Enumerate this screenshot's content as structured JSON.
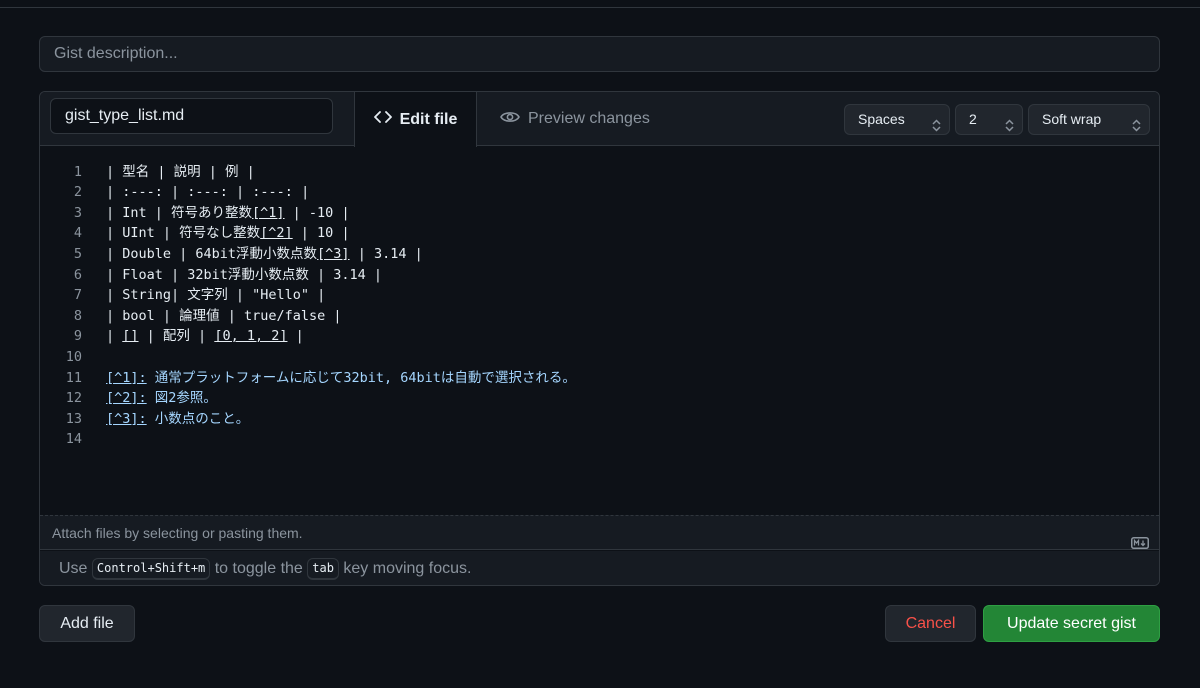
{
  "description": {
    "placeholder": "Gist description..."
  },
  "file": {
    "name": "gist_type_list.md",
    "tabs": {
      "edit": "Edit file",
      "preview": "Preview changes"
    },
    "indent_mode": "Spaces",
    "indent_size": "2",
    "wrap_mode": "Soft wrap"
  },
  "editor": {
    "lines": [
      {
        "n": "1",
        "segments": [
          {
            "t": "| 型名 | 説明 | 例 |"
          }
        ]
      },
      {
        "n": "2",
        "segments": [
          {
            "t": "| :---: | :---: | :---: |"
          }
        ]
      },
      {
        "n": "3",
        "segments": [
          {
            "t": "| Int | 符号あり整数"
          },
          {
            "t": "[^1]",
            "u": true
          },
          {
            "t": " | -10 |"
          }
        ]
      },
      {
        "n": "4",
        "segments": [
          {
            "t": "| UInt | 符号なし整数"
          },
          {
            "t": "[^2]",
            "u": true
          },
          {
            "t": " | 10 |"
          }
        ]
      },
      {
        "n": "5",
        "segments": [
          {
            "t": "| Double | 64bit浮動小数点数"
          },
          {
            "t": "[^3]",
            "u": true
          },
          {
            "t": " | 3.14 |"
          }
        ]
      },
      {
        "n": "6",
        "segments": [
          {
            "t": "| Float | 32bit浮動小数点数 | 3.14 |"
          }
        ]
      },
      {
        "n": "7",
        "segments": [
          {
            "t": "| String| 文字列 | \"Hello\" |"
          }
        ]
      },
      {
        "n": "8",
        "segments": [
          {
            "t": "| bool | 論理値 | true/false |"
          }
        ]
      },
      {
        "n": "9",
        "segments": [
          {
            "t": "| "
          },
          {
            "t": "[]",
            "u": true
          },
          {
            "t": " | 配列 | "
          },
          {
            "t": "[0, 1, 2]",
            "u": true
          },
          {
            "t": " |"
          }
        ]
      },
      {
        "n": "10",
        "segments": []
      },
      {
        "n": "11",
        "segments": [
          {
            "t": "[^1]:",
            "u": true,
            "fn": true
          },
          {
            "t": " 通常プラットフォームに応じて32bit, 64bitは自動で選択される。",
            "fn": true
          }
        ]
      },
      {
        "n": "12",
        "segments": [
          {
            "t": "[^2]:",
            "u": true,
            "fn": true
          },
          {
            "t": " 図2参照。",
            "fn": true
          }
        ]
      },
      {
        "n": "13",
        "segments": [
          {
            "t": "[^3]:",
            "u": true,
            "fn": true
          },
          {
            "t": " 小数点のこと。",
            "fn": true
          }
        ]
      },
      {
        "n": "14",
        "segments": []
      }
    ]
  },
  "attach": {
    "text": "Attach files by selecting or pasting them.",
    "icon": "markdown-icon"
  },
  "hint": {
    "prefix": "Use",
    "shortcut": "Control+Shift+m",
    "middle": "to toggle the",
    "key": "tab",
    "suffix": "key moving focus."
  },
  "buttons": {
    "add_file": "Add file",
    "cancel": "Cancel",
    "update": "Update secret gist"
  },
  "colors": {
    "background": "#0d1117",
    "panel": "#161b22",
    "border": "#30363d",
    "primary": "#238636",
    "danger": "#f85149"
  }
}
